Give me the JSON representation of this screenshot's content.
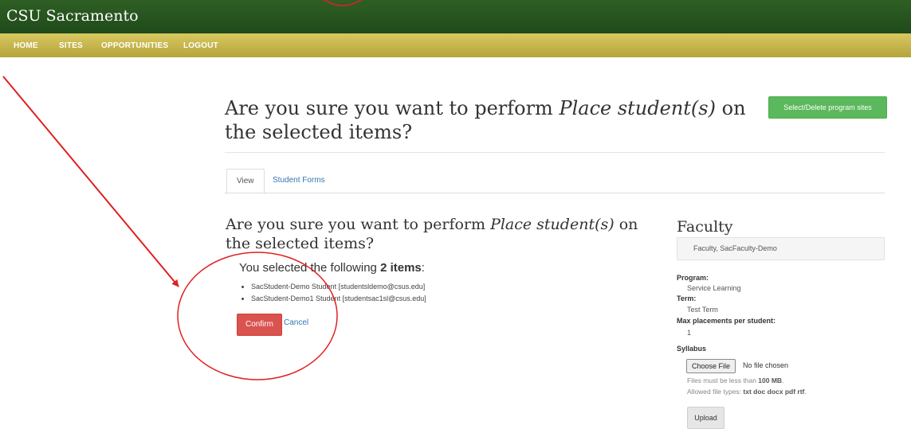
{
  "header": {
    "brand": "CSU Sacramento"
  },
  "nav": {
    "items": [
      "HOME",
      "SITES",
      "OPPORTUNITIES",
      "LOGOUT"
    ]
  },
  "page": {
    "title_pre": "Are you sure you want to perform ",
    "title_action": "Place student(s)",
    "title_post": " on the selected items?",
    "select_delete_button": "Select/Delete program sites"
  },
  "tabs": [
    {
      "label": "View"
    },
    {
      "label": "Student Forms"
    }
  ],
  "confirm": {
    "heading_pre": "Are you sure you want to perform ",
    "heading_action": "Place student(s)",
    "heading_post": " on the selected items?",
    "selected_pre": "You selected the following ",
    "selected_count": "2 items",
    "selected_post": ":",
    "items": [
      "SacStudent-Demo Student [studentsldemo@csus.edu]",
      "SacStudent-Demo1 Student [studentsac1sl@csus.edu]"
    ],
    "confirm_label": "Confirm",
    "cancel_label": "Cancel"
  },
  "faculty": {
    "title": "Faculty",
    "name": "Faculty, SacFaculty-Demo",
    "program_label": "Program:",
    "program_value": "Service Learning",
    "term_label": "Term:",
    "term_value": "Test Term",
    "max_label": "Max placements per student:",
    "max_value": "1",
    "syllabus_label": "Syllabus",
    "choose_file_label": "Choose File",
    "no_file_text": "No file chosen",
    "size_pre": "Files must be less than ",
    "size_value": "100 MB",
    "size_post": ".",
    "types_pre": "Allowed file types: ",
    "types_value": "txt doc docx pdf rtf",
    "types_post": ".",
    "upload_label": "Upload"
  },
  "colors": {
    "topbar": "#1f4a1a",
    "navbar": "#c8b84a",
    "success": "#5cb85c",
    "danger": "#d9534f",
    "link": "#3277b3",
    "annotation": "#e02020"
  }
}
